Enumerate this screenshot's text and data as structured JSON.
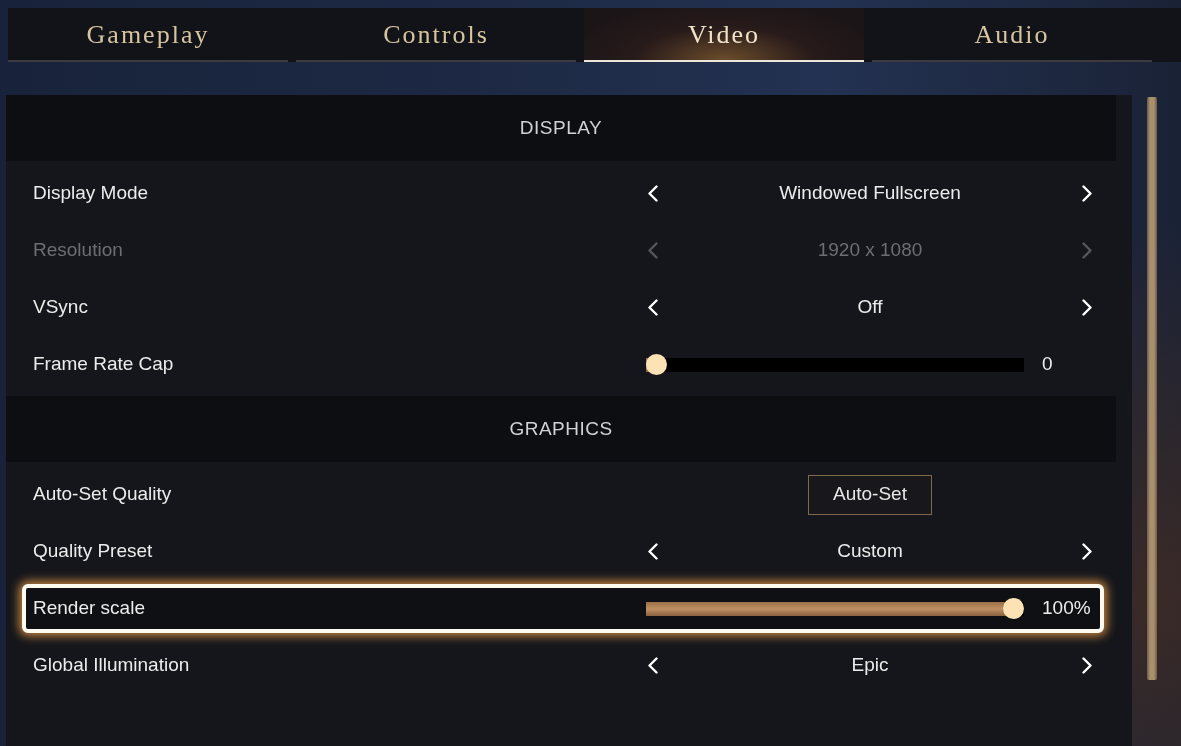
{
  "tabs": [
    {
      "label": "Gameplay",
      "selected": false
    },
    {
      "label": "Controls",
      "selected": false
    },
    {
      "label": "Video",
      "selected": true
    },
    {
      "label": "Audio",
      "selected": false
    }
  ],
  "sections": [
    {
      "title": "DISPLAY",
      "settings": [
        {
          "kind": "selector",
          "label": "Display Mode",
          "value": "Windowed Fullscreen",
          "disabled": false,
          "focused": false
        },
        {
          "kind": "selector",
          "label": "Resolution",
          "value": "1920 x 1080",
          "disabled": true,
          "focused": false
        },
        {
          "kind": "selector",
          "label": "VSync",
          "value": "Off",
          "disabled": false,
          "focused": false
        },
        {
          "kind": "slider",
          "label": "Frame Rate Cap",
          "level": 0,
          "reading": "0",
          "disabled": false,
          "focused": false
        }
      ]
    },
    {
      "title": "GRAPHICS",
      "settings": [
        {
          "kind": "button",
          "label": "Auto-Set Quality",
          "button": "Auto-Set",
          "disabled": false,
          "focused": false
        },
        {
          "kind": "selector",
          "label": "Quality Preset",
          "value": "Custom",
          "disabled": false,
          "focused": false
        },
        {
          "kind": "slider",
          "label": "Render scale",
          "level": 1,
          "reading": "100%",
          "disabled": false,
          "focused": true
        },
        {
          "kind": "selector",
          "label": "Global Illumination",
          "value": "Epic",
          "disabled": false,
          "focused": false
        }
      ]
    }
  ]
}
